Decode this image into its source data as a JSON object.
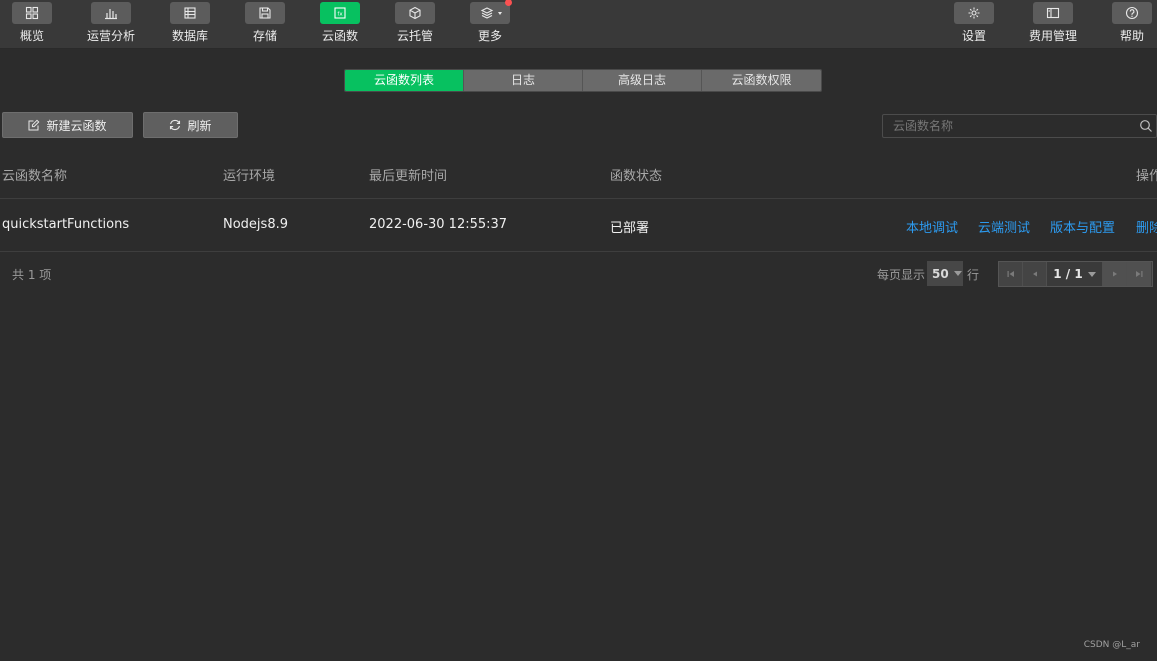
{
  "toolbar": {
    "left": [
      {
        "label": "概览",
        "icon": "grid-icon"
      },
      {
        "label": "运营分析",
        "icon": "bar-chart-icon"
      },
      {
        "label": "数据库",
        "icon": "database-icon"
      },
      {
        "label": "存储",
        "icon": "storage-icon"
      },
      {
        "label": "云函数",
        "icon": "cloud-function-icon"
      },
      {
        "label": "云托管",
        "icon": "box-icon"
      },
      {
        "label": "更多",
        "icon": "layers-icon"
      }
    ],
    "right": [
      {
        "label": "设置",
        "icon": "gear-icon"
      },
      {
        "label": "费用管理",
        "icon": "billing-icon"
      },
      {
        "label": "帮助",
        "icon": "help-icon"
      }
    ],
    "active": "云函数"
  },
  "tabs": [
    "云函数列表",
    "日志",
    "高级日志",
    "云函数权限"
  ],
  "actions": {
    "new_label": "新建云函数",
    "refresh_label": "刷新"
  },
  "search": {
    "placeholder": "云函数名称"
  },
  "table": {
    "headers": {
      "name": "云函数名称",
      "runtime": "运行环境",
      "updated": "最后更新时间",
      "status": "函数状态",
      "ops": "操作"
    },
    "rows": [
      {
        "name": "quickstartFunctions",
        "runtime": "Nodejs8.9",
        "updated": "2022-06-30 12:55:37",
        "status": "已部署",
        "ops": [
          "本地调试",
          "云端测试",
          "版本与配置",
          "删除"
        ]
      }
    ]
  },
  "footer": {
    "total": "共 1 项",
    "per_page_label": "每页显示",
    "per_page_value": "50",
    "row_word": "行",
    "page": "1 / 1"
  },
  "watermark": "CSDN @L_ar",
  "colors": {
    "accent": "#07c160",
    "link": "#2c9bf0",
    "background": "#2c2c2c",
    "toolbar": "#393939"
  }
}
